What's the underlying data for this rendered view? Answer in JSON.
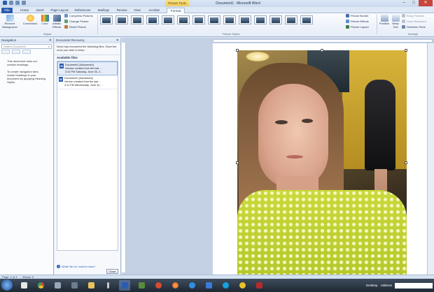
{
  "window": {
    "title": "Document1 - Microsoft Word",
    "context_tab": "Picture Tools",
    "min": "–",
    "max": "□",
    "close": "✕"
  },
  "tabs": [
    "File",
    "Home",
    "Insert",
    "Page Layout",
    "References",
    "Mailings",
    "Review",
    "View",
    "Acrobat",
    "Format"
  ],
  "ribbon": {
    "remove_background": "Remove Background",
    "corrections": "Corrections",
    "color": "Color",
    "artistic_effects": "Artistic Effects",
    "compress": "Compress Pictures",
    "change": "Change Picture",
    "reset": "Reset Picture",
    "adjust_label": "Adjust",
    "styles_label": "Picture Styles",
    "border": "Picture Border",
    "effects": "Picture Effects",
    "layout": "Picture Layout",
    "position": "Position",
    "wrap_text": "Wrap Text",
    "bring_forward": "Bring Forward",
    "send_backward": "Send Backward",
    "selection_pane": "Selection Pane",
    "arrange_label": "Arrange"
  },
  "navigation": {
    "title": "Navigation",
    "close": "✕",
    "search_placeholder": "Search Document",
    "message": "This document does not contain headings.\n\nTo create navigation tabs, create headings in your document by applying Heading Styles."
  },
  "recovery": {
    "title": "Document Recovery",
    "close": "✕",
    "message": "Word has recovered the following files. Save the ones you wish to keep.",
    "available_files": "Available files",
    "files": [
      {
        "name": "Document1 [Autosaved]",
        "line2": "Version created from the last ...",
        "line3": "3:15 PM Saturday, June 06, 2..."
      },
      {
        "name": "Document1 [Autosaved]",
        "line2": "Version created from the last ...",
        "line3": "3:11 PM Wednesday, June 10, ..."
      }
    ],
    "help_link": "Which file do I want to save?",
    "close_button": "Close"
  },
  "statusbar": {
    "page": "Page: 1 of 1",
    "words": "Words: 0"
  },
  "taskbar": {
    "desktop": "Desktop",
    "address": "Address"
  }
}
